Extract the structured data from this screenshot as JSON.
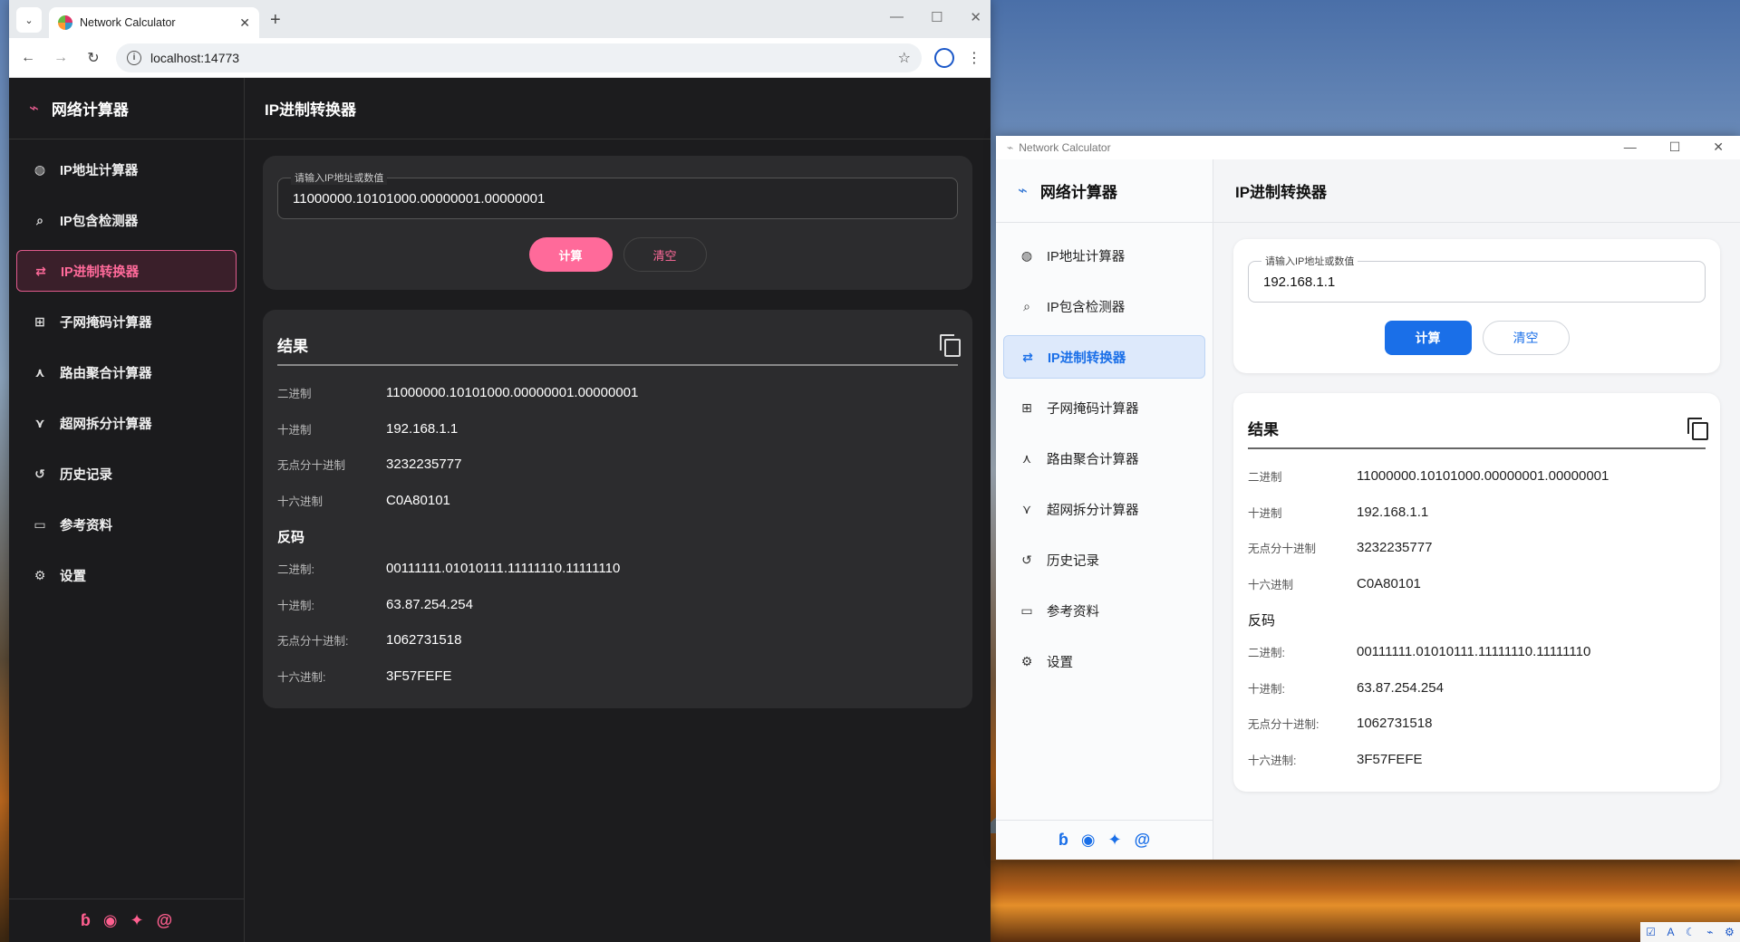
{
  "browser": {
    "tab_title": "Network Calculator",
    "tab_close": "✕",
    "new_tab": "+",
    "url": "localhost:14773",
    "window_controls": [
      "—",
      "☐",
      "✕"
    ]
  },
  "app": {
    "brand": "网络计算器",
    "page_title": "IP进制转换器",
    "nav": [
      {
        "label": "IP地址计算器",
        "icon": "globe-icon"
      },
      {
        "label": "IP包含检测器",
        "icon": "search-icon"
      },
      {
        "label": "IP进制转换器",
        "icon": "swap-icon"
      },
      {
        "label": "子网掩码计算器",
        "icon": "subnet-icon"
      },
      {
        "label": "路由聚合计算器",
        "icon": "merge-icon"
      },
      {
        "label": "超网拆分计算器",
        "icon": "split-icon"
      },
      {
        "label": "历史记录",
        "icon": "history-icon"
      },
      {
        "label": "参考资料",
        "icon": "book-icon"
      },
      {
        "label": "设置",
        "icon": "gear-icon"
      }
    ],
    "input_label": "请输入IP地址或数值",
    "calc_button": "计算",
    "clear_button": "清空",
    "results_title": "结果",
    "results": [
      {
        "label": "二进制",
        "value": "11000000.10101000.00000001.00000001"
      },
      {
        "label": "十进制",
        "value": "192.168.1.1"
      },
      {
        "label": "无点分十进制",
        "value": "3232235777"
      },
      {
        "label": "十六进制",
        "value": "C0A80101"
      }
    ],
    "inverse_title": "反码",
    "inverse": [
      {
        "label": "二进制:",
        "value": "00111111.01010111.11111110.11111110"
      },
      {
        "label": "十进制:",
        "value": "63.87.254.254"
      },
      {
        "label": "无点分十进制:",
        "value": "1062731518"
      },
      {
        "label": "十六进制:",
        "value": "3F57FEFE"
      }
    ],
    "footer_icons": [
      "blog-icon",
      "github-icon",
      "bluesky-icon",
      "email-icon"
    ]
  },
  "dark_window": {
    "input_value": "11000000.10101000.00000001.00000001",
    "accent": "#ff6a9a"
  },
  "light_window": {
    "title": "Network Calculator",
    "input_value": "192.168.1.1",
    "accent": "#1a6fe8"
  }
}
